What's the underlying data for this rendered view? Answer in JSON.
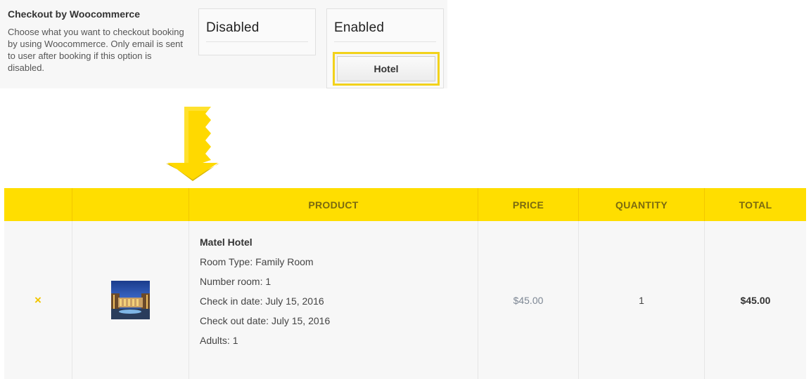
{
  "settings": {
    "title": "Checkout by Woocommerce",
    "description": "Choose what you want to checkout booking by using Woocommerce. Only email is sent to user after booking if this option is disabled.",
    "option_disabled": "Disabled",
    "option_enabled": "Enabled",
    "hotel_button": "Hotel"
  },
  "colors": {
    "accent": "#ffde00",
    "highlight_border": "#f2d21b",
    "arrow": "#ffd900"
  },
  "cart": {
    "headers": [
      "",
      "",
      "PRODUCT",
      "PRICE",
      "QUANTITY",
      "TOTAL"
    ],
    "row": {
      "remove_icon": "×",
      "thumbnail": "hotel-image",
      "product_name": "Matel Hotel",
      "room_type": "Room Type: Family Room",
      "number_room": "Number room: 1",
      "check_in": "Check in date: July 15, 2016",
      "check_out": "Check out date: July 15, 2016",
      "adults": "Adults: 1",
      "price": "$45.00",
      "quantity": "1",
      "total": "$45.00"
    }
  }
}
